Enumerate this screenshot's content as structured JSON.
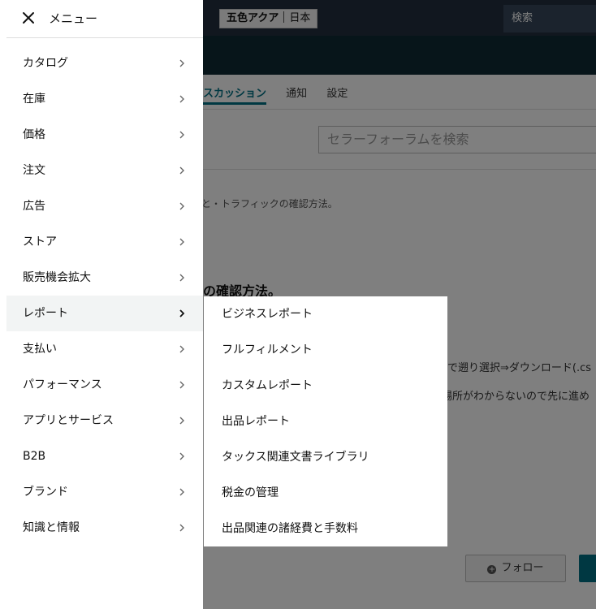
{
  "background": {
    "brand": {
      "name": "五色アクア",
      "region": "日本"
    },
    "search_label": "検索",
    "tabs": [
      {
        "label": "スカッション"
      },
      {
        "label": "通知"
      },
      {
        "label": "設定"
      }
    ],
    "forum_search_placeholder": "セラーフォーラムを検索",
    "breadcrumb_fragment": "と・トラフィックの確認方法。",
    "heading_fragment": "の確認方法。",
    "body_fragment_1": "まで遡り選択⇒ダウンロード(.cs",
    "body_fragment_2": "場所がわからないので先に進め",
    "follow_label": "フォロー"
  },
  "menu": {
    "title": "メニュー",
    "items": [
      {
        "label": "カタログ"
      },
      {
        "label": "在庫"
      },
      {
        "label": "価格"
      },
      {
        "label": "注文"
      },
      {
        "label": "広告"
      },
      {
        "label": "ストア"
      },
      {
        "label": "販売機会拡大"
      },
      {
        "label": "レポート"
      },
      {
        "label": "支払い"
      },
      {
        "label": "パフォーマンス"
      },
      {
        "label": "アプリとサービス"
      },
      {
        "label": "B2B"
      },
      {
        "label": "ブランド"
      },
      {
        "label": "知識と情報"
      }
    ],
    "active_item": "レポート"
  },
  "submenu": {
    "items": [
      {
        "label": "ビジネスレポート"
      },
      {
        "label": "フルフィルメント"
      },
      {
        "label": "カスタムレポート"
      },
      {
        "label": "出品レポート"
      },
      {
        "label": "タックス関連文書ライブラリ"
      },
      {
        "label": "税金の管理"
      },
      {
        "label": "出品関連の諸経費と手数料"
      }
    ]
  },
  "colors": {
    "accent": "#007185",
    "header_bg": "#232f3e",
    "overlay": "rgba(0,0,0,0.5)",
    "active_row": "#f2f4f4"
  }
}
